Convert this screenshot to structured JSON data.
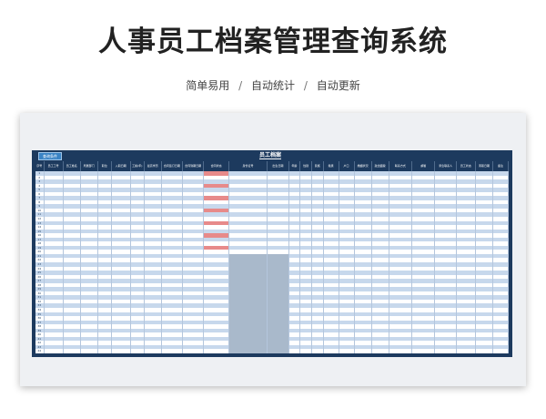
{
  "banner": {
    "title": "人事员工档案管理查询系统",
    "subtitle_parts": [
      "简单易用",
      "自动统计",
      "自动更新"
    ],
    "separator": "/"
  },
  "sheet": {
    "title": "员工档案",
    "query_button": "查询条件",
    "columns": [
      "序号",
      "员工工号",
      "员工姓名",
      "所属部门",
      "职位",
      "入职日期",
      "工龄(年)",
      "最高学历",
      "合同签订日期",
      "合同到期日期",
      "合同状态",
      "身份证号",
      "出生日期",
      "年龄",
      "性别",
      "民族",
      "籍贯",
      "户口",
      "婚姻状况",
      "政治面貌",
      "联系方式",
      "邮箱",
      "紧急联系人",
      "员工状态",
      "离职日期",
      "备注"
    ],
    "total_rows": 44,
    "filled_rows": 20,
    "accent_color": "#1d3a5e",
    "row_color_dark": "#c7d8ec",
    "alert_color": "#e78a8a"
  }
}
